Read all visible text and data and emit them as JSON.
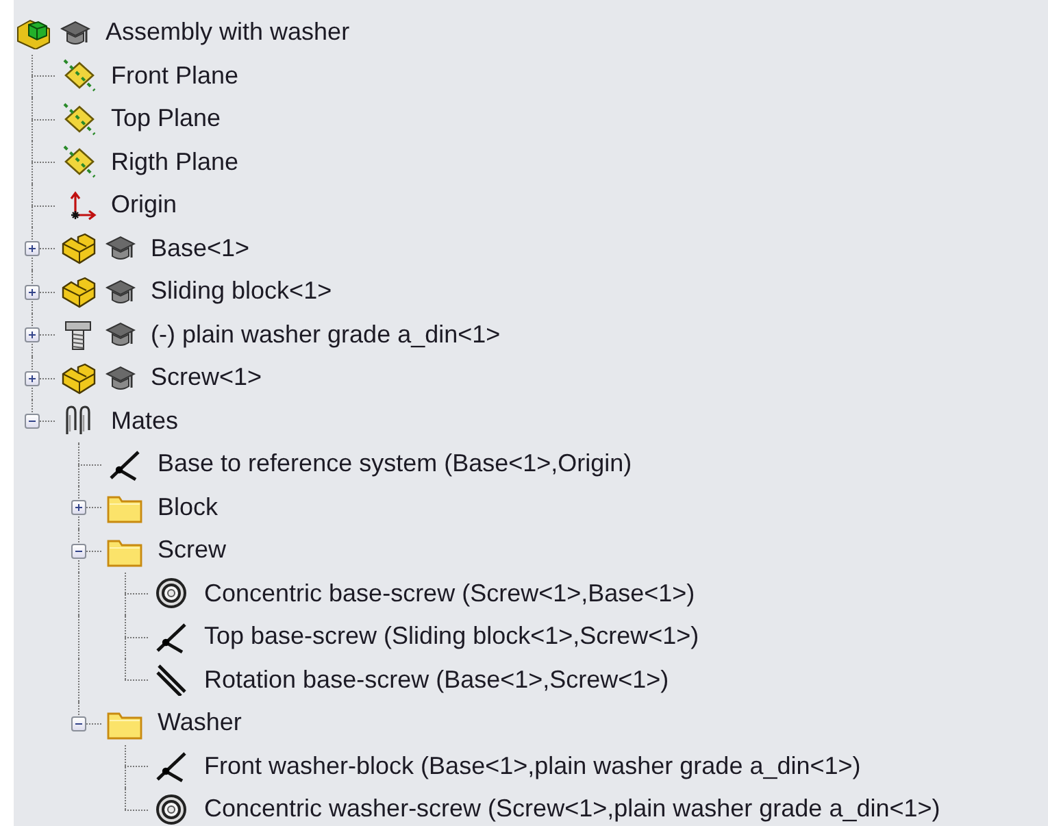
{
  "tree": {
    "label": "Assembly with washer",
    "kind": "assembly",
    "children": [
      {
        "label": "Front Plane",
        "kind": "plane"
      },
      {
        "label": "Top Plane",
        "kind": "plane"
      },
      {
        "label": "Rigth Plane",
        "kind": "plane"
      },
      {
        "label": "Origin",
        "kind": "origin"
      },
      {
        "label": "Base<1>",
        "kind": "part",
        "expanded": false
      },
      {
        "label": "Sliding block<1>",
        "kind": "part",
        "expanded": false
      },
      {
        "label": "(-) plain washer grade a_din<1>",
        "kind": "fastener",
        "expanded": false
      },
      {
        "label": "Screw<1>",
        "kind": "part",
        "expanded": false
      },
      {
        "label": "Mates",
        "kind": "mates",
        "expanded": true,
        "children": [
          {
            "label": "Base to reference system (Base<1>,Origin)",
            "kind": "coincident"
          },
          {
            "label": "Block",
            "kind": "folder",
            "expanded": false
          },
          {
            "label": "Screw",
            "kind": "folder",
            "expanded": true,
            "children": [
              {
                "label": "Concentric base-screw (Screw<1>,Base<1>)",
                "kind": "concentric"
              },
              {
                "label": "Top base-screw (Sliding block<1>,Screw<1>)",
                "kind": "coincident"
              },
              {
                "label": "Rotation base-screw (Base<1>,Screw<1>)",
                "kind": "parallel"
              }
            ]
          },
          {
            "label": "Washer",
            "kind": "folder",
            "expanded": true,
            "children": [
              {
                "label": "Front washer-block (Base<1>,plain washer grade a_din<1>)",
                "kind": "coincident"
              },
              {
                "label": "Concentric washer-screw (Screw<1>,plain washer grade a_din<1>)",
                "kind": "concentric"
              }
            ]
          }
        ]
      }
    ]
  }
}
